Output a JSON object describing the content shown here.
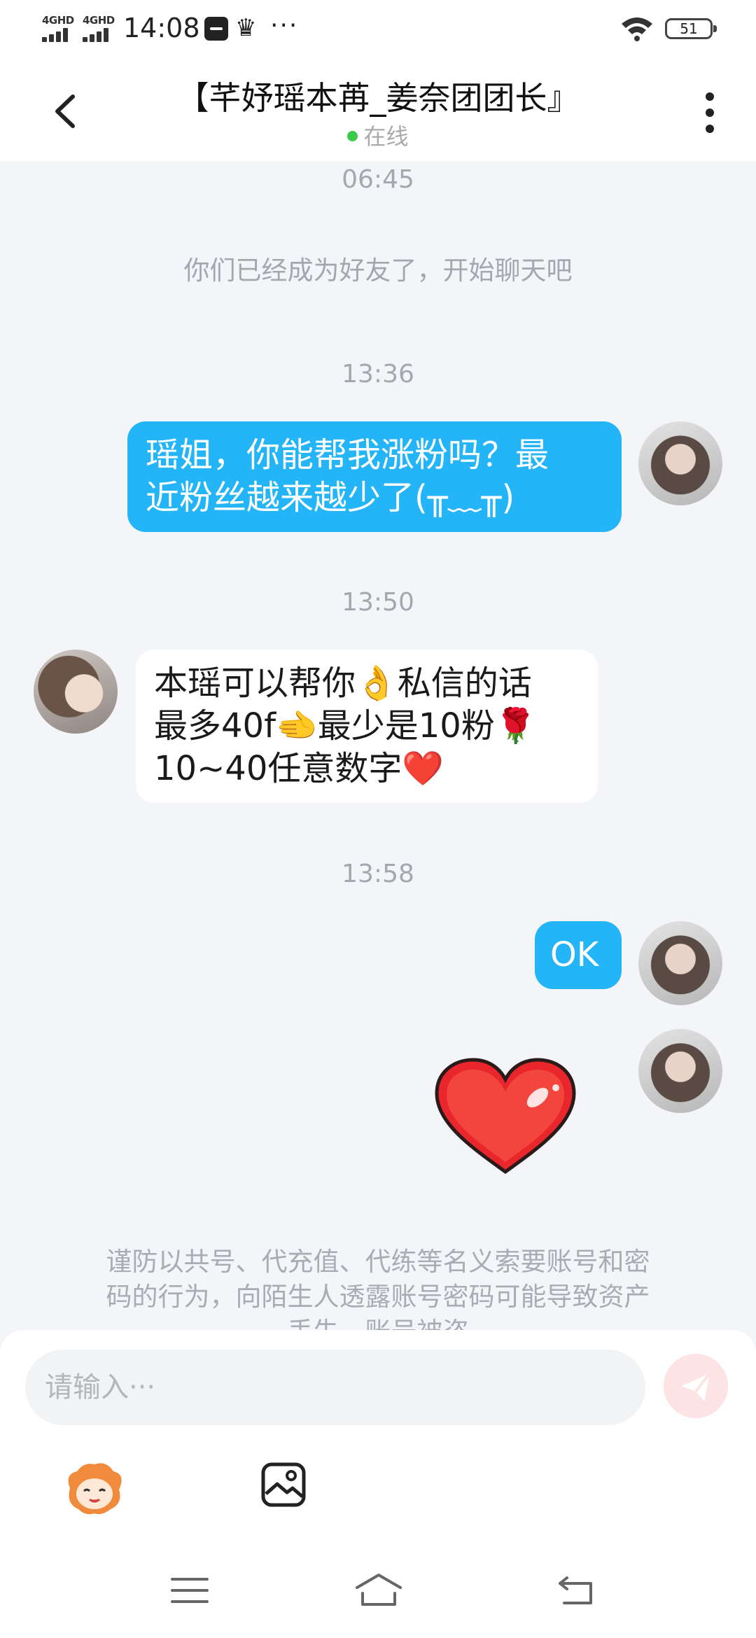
{
  "status_bar": {
    "sim1": "4GHD",
    "sim2": "4GHD",
    "time": "14:08",
    "more": "···",
    "battery": "51",
    "icons": [
      "signal-icon",
      "signal-icon",
      "app-notification-icon",
      "crown-icon",
      "more-dots-icon",
      "wifi-icon",
      "battery-icon"
    ]
  },
  "header": {
    "title": "【芊妤瑶本苒_姜奈团团长』",
    "status": "在线",
    "status_color": "#3dc94a",
    "icons": [
      "back-arrow-icon",
      "more-vertical-icon"
    ]
  },
  "messages": {
    "t1": "06:45",
    "system": "你们已经成为好友了，开始聊天吧",
    "t2": "13:36",
    "m1_l1": "瑶姐，你能帮我涨粉吗？最",
    "m1_l2": "近粉丝越来越少了(╥﹏╥)",
    "t3": "13:50",
    "m2_l1": "本瑶可以帮你👌私信的话",
    "m2_l2": "最多40f🫲最少是10粉🌹",
    "m2_l3": "10~40任意数字❤️",
    "t4": "13:58",
    "m3": "OK",
    "m4_sticker": "heart-sticker",
    "warning_l1": "谨防以共号、代充值、代练等名义索要账号和密",
    "warning_l2": "码的行为，向陌生人透露账号密码可能导致资产",
    "warning_l3": "丢失、账号被盗"
  },
  "input": {
    "placeholder": "请输入···",
    "send_icon": "send-icon",
    "tools": [
      "emoji-icon",
      "image-icon"
    ]
  },
  "nav": {
    "icons": [
      "menu-icon",
      "home-icon",
      "back-icon"
    ]
  },
  "colors": {
    "outgoing_bubble": "#23b5f7",
    "incoming_bubble": "#ffffff",
    "chat_background": "#f3f5f9",
    "send_button": "#fde3e3"
  }
}
